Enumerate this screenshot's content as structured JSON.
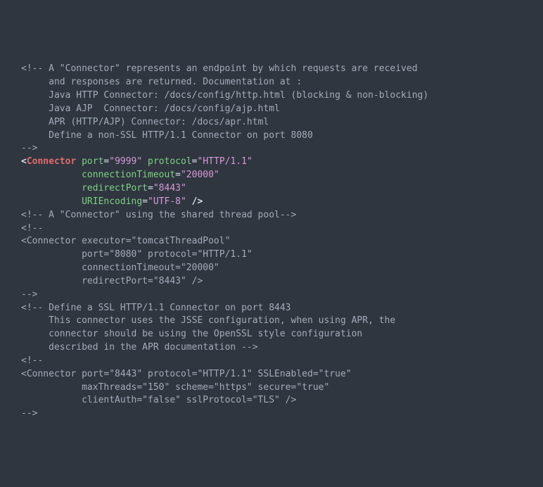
{
  "code": {
    "comment1": {
      "open": "<!--",
      "l1": " A \"Connector\" represents an endpoint by which requests are received",
      "l2": "     and responses are returned. Documentation at :",
      "l3": "     Java HTTP Connector: /docs/config/http.html (blocking & non-blocking)",
      "l4": "     Java AJP  Connector: /docs/config/ajp.html",
      "l5": "     APR (HTTP/AJP) Connector: /docs/apr.html",
      "l6": "     Define a non-SSL HTTP/1.1 Connector on port 8080",
      "close": "-->"
    },
    "connector1": {
      "open": "<",
      "tag": "Connector",
      "a1": "port",
      "v1": "\"9999\"",
      "a2": "protocol",
      "v2": "\"HTTP/1.1\"",
      "a3": "connectionTimeout",
      "v3": "\"20000\"",
      "a4": "redirectPort",
      "v4": "\"8443\"",
      "a5": "URIEncoding",
      "v5": "\"UTF-8\"",
      "close": "/>",
      "eq": "="
    },
    "comment2": {
      "full": "<!-- A \"Connector\" using the shared thread pool-->"
    },
    "comment3": {
      "open": "<!--",
      "l1": "<Connector executor=\"tomcatThreadPool\"",
      "l2": "           port=\"8080\" protocol=\"HTTP/1.1\"",
      "l3": "           connectionTimeout=\"20000\"",
      "l4": "           redirectPort=\"8443\" />",
      "close": "-->"
    },
    "comment4": {
      "open": "<!--",
      "l1": " Define a SSL HTTP/1.1 Connector on port 8443",
      "l2": "     This connector uses the JSSE configuration, when using APR, the",
      "l3": "     connector should be using the OpenSSL style configuration",
      "l4": "     described in the APR documentation ",
      "close": "-->"
    },
    "comment5": {
      "open": "<!--",
      "l1": "<Connector port=\"8443\" protocol=\"HTTP/1.1\" SSLEnabled=\"true\"",
      "l2": "           maxThreads=\"150\" scheme=\"https\" secure=\"true\"",
      "l3": "           clientAuth=\"false\" sslProtocol=\"TLS\" />",
      "close": "-->"
    }
  }
}
